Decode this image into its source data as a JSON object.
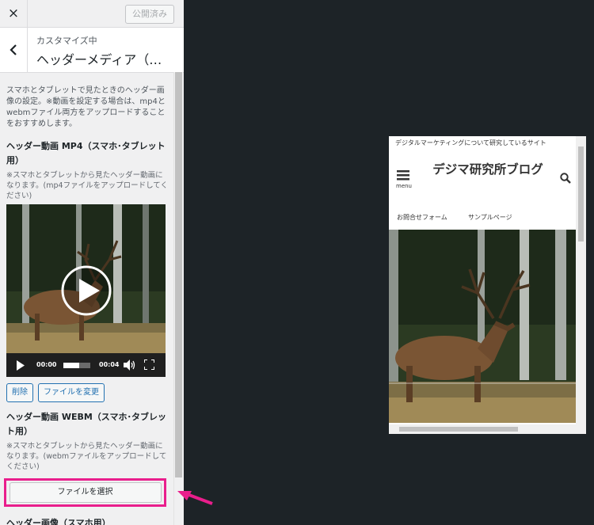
{
  "topbar": {
    "close_icon": "×",
    "publish_label": "公開済み"
  },
  "section": {
    "back_icon": "‹",
    "breadcrumb": "カスタマイズ中",
    "title": "ヘッダーメディア（…"
  },
  "description": "スマホとタブレットで見たときのヘッダー画像の設定。※動画を設定する場合は、mp4とwebmファイル両方をアップロードすることをおすすめします。",
  "mp4_control": {
    "title": "ヘッダー動画 MP4（スマホ･タブレット用）",
    "note": "※スマホとタブレットから見たヘッダー動画になります。(mp4ファイルをアップロードしてください)",
    "player": {
      "current_time": "00:00",
      "duration": "00:04",
      "progress": 0.0,
      "buffered": 0.6
    },
    "remove_label": "削除",
    "change_label": "ファイルを変更"
  },
  "webm_control": {
    "title": "ヘッダー動画 WEBM（スマホ･タブレット用）",
    "note": "※スマホとタブレットから見たヘッダー動画になります。(webmファイルをアップロードしてください)",
    "select_label": "ファイルを選択"
  },
  "next_control_title": "ヘッダー画像（スマホ用）",
  "preview": {
    "tagline": "デジタルマーケティングについて研究しているサイト",
    "site_title": "デジマ研究所ブログ",
    "menu_label": "menu",
    "nav": [
      "お問合せフォーム",
      "サンプルページ"
    ]
  },
  "colors": {
    "highlight": "#e91e8c",
    "accent": "#2271b1",
    "dark_bg": "#1d2327"
  }
}
